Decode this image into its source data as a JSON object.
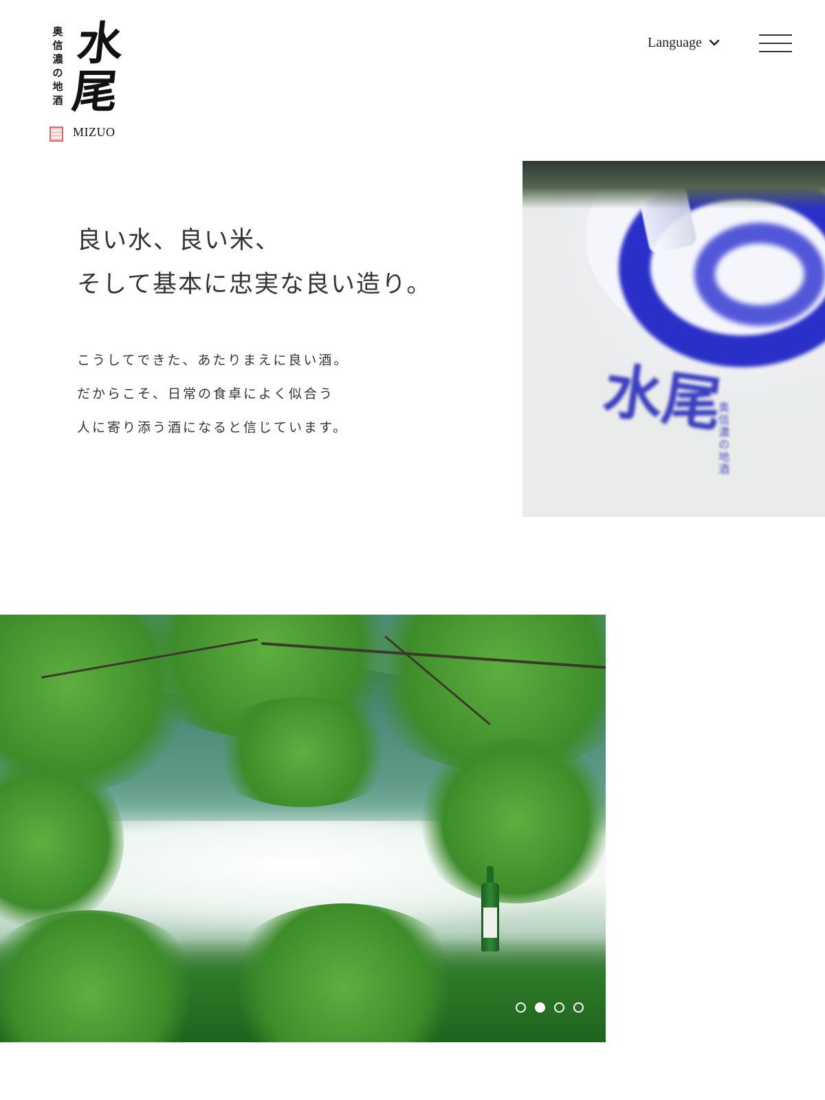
{
  "logo": {
    "subtitle_chars": [
      "奥",
      "信",
      "濃",
      "の",
      "地",
      "酒"
    ],
    "main_chars": [
      "水",
      "尾"
    ],
    "english": "MIZUO"
  },
  "header": {
    "language_label": "Language",
    "language_icon": "chevron-down-icon",
    "menu_icon": "hamburger-icon"
  },
  "intro": {
    "headline": [
      "良い水、良い米、",
      "そして基本に忠実な良い造り。"
    ],
    "body": [
      "こうしてできた、あたりまえに良い酒。",
      "だからこそ、日常の食卓によく似合う",
      "人に寄り添う酒になると信じています。"
    ]
  },
  "photos": {
    "cup": {
      "mark": "水尾",
      "sub_chars": [
        "奥",
        "信",
        "濃",
        "の",
        "地",
        "酒"
      ]
    }
  },
  "slider": {
    "count": 4,
    "active_index": 1
  },
  "colors": {
    "text": "#222222",
    "cup_blue": "#2a2fc8",
    "seal_red": "#d46b6b",
    "dot": "#ffffff"
  }
}
